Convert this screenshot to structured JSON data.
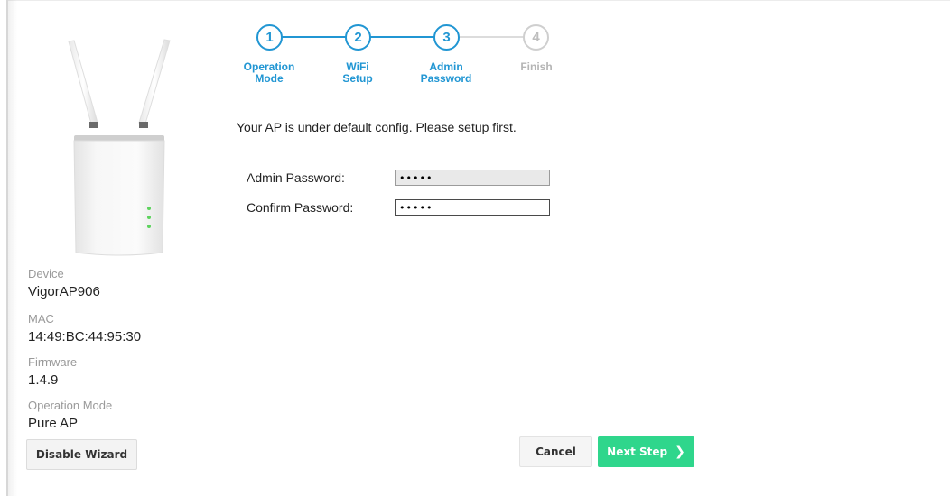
{
  "stepper": {
    "steps": [
      {
        "number": "1",
        "label_line1": "Operation",
        "label_line2": "Mode",
        "state": "done"
      },
      {
        "number": "2",
        "label_line1": "WiFi",
        "label_line2": "Setup",
        "state": "done"
      },
      {
        "number": "3",
        "label_line1": "Admin",
        "label_line2": "Password",
        "state": "current"
      },
      {
        "number": "4",
        "label_line1": "Finish",
        "label_line2": "",
        "state": "pending"
      }
    ],
    "active_color": "#2196d3",
    "inactive_color": "#cfcfcf"
  },
  "message": "Your AP is under default config. Please setup first.",
  "form": {
    "admin_password_label": "Admin Password:",
    "admin_password_value": "•••••",
    "confirm_password_label": "Confirm Password:",
    "confirm_password_value": "•••••"
  },
  "device_info": {
    "device_label": "Device",
    "device_value": "VigorAP906",
    "mac_label": "MAC",
    "mac_value": "14:49:BC:44:95:30",
    "firmware_label": "Firmware",
    "firmware_value": "1.4.9",
    "opmode_label": "Operation Mode",
    "opmode_value": "Pure AP"
  },
  "buttons": {
    "disable_wizard": "Disable Wizard",
    "cancel": "Cancel",
    "next_step": "Next Step",
    "next_color": "#2fd68c"
  }
}
